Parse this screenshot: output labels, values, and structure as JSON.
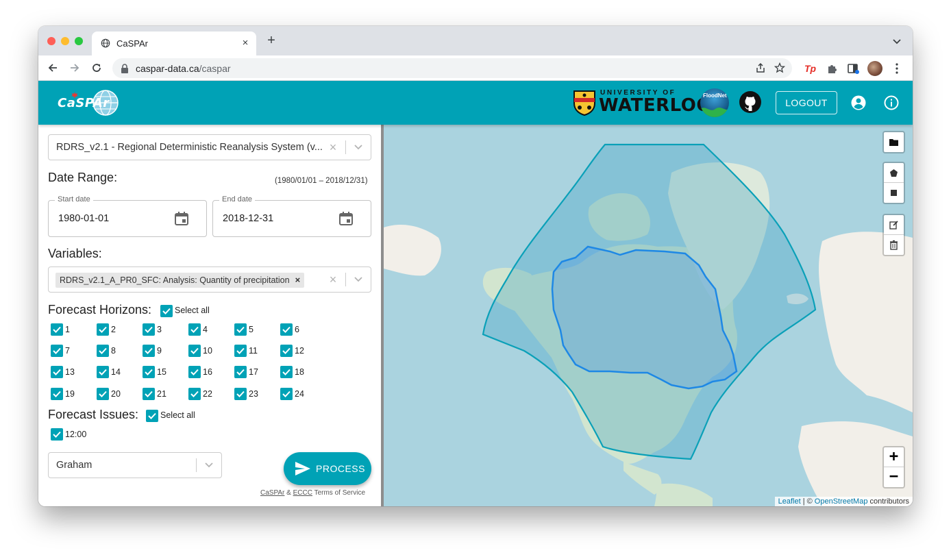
{
  "browser": {
    "tab_title": "CaSPAr",
    "new_tab": "+",
    "tab_close": "×",
    "url_host": "caspar-data.ca",
    "url_path": "/caspar"
  },
  "header": {
    "logo_text": "CaSPAr",
    "uw_small": "UNIVERSITY OF",
    "uw_large": "WATERLOO",
    "floodnet": "FloodNet",
    "logout_label": "LOGOUT",
    "accent_color": "#00a2b6"
  },
  "dataset": {
    "selected": "RDRS_v2.1 - Regional Deterministic Reanalysis System (v..."
  },
  "date_range": {
    "heading": "Date Range:",
    "range_note": "(1980/01/01 – 2018/12/31)",
    "start_label": "Start date",
    "start_value": "1980-01-01",
    "end_label": "End date",
    "end_value": "2018-12-31"
  },
  "variables": {
    "heading": "Variables:",
    "chip": "RDRS_v2.1_A_PR0_SFC: Analysis: Quantity of precipitation",
    "chip_remove": "×"
  },
  "forecast_horizons": {
    "heading": "Forecast Horizons:",
    "select_all": "Select all",
    "items": [
      "1",
      "2",
      "3",
      "4",
      "5",
      "6",
      "7",
      "8",
      "9",
      "10",
      "11",
      "12",
      "13",
      "14",
      "15",
      "16",
      "17",
      "18",
      "19",
      "20",
      "21",
      "22",
      "23",
      "24"
    ]
  },
  "forecast_issues": {
    "heading": "Forecast Issues:",
    "select_all": "Select all",
    "items": [
      "12:00"
    ]
  },
  "server": {
    "selected": "Graham"
  },
  "process_label": "PROCESS",
  "footer": {
    "caspar": "CaSPAr",
    "amp": "&",
    "eccc": "ECCC",
    "tos": "Terms of Service"
  },
  "map": {
    "zoom_in": "+",
    "zoom_out": "−",
    "attribution_leaflet": "Leaflet",
    "attribution_sep": "| ©",
    "attribution_osm": "OpenStreetMap",
    "attribution_contrib": "contributors"
  }
}
